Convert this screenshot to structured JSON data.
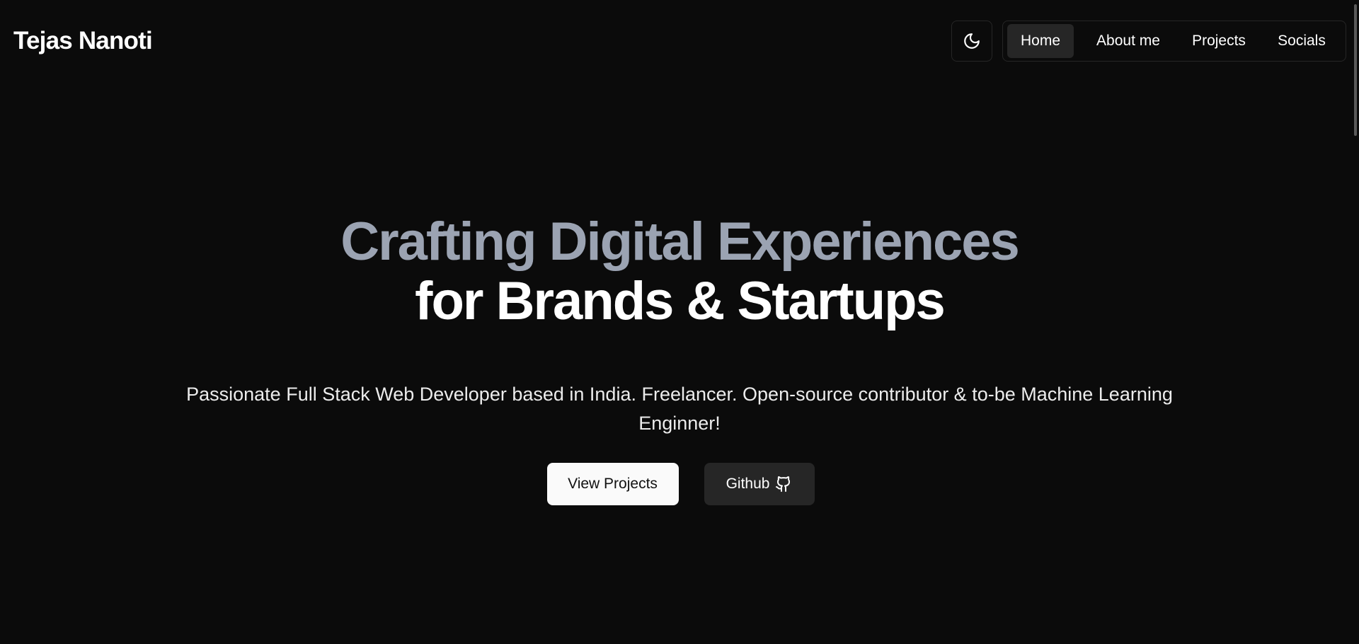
{
  "header": {
    "brand": "Tejas Nanoti",
    "theme_toggle_icon": "moon-icon",
    "nav": [
      {
        "label": "Home",
        "active": true
      },
      {
        "label": "About me",
        "active": false
      },
      {
        "label": "Projects",
        "active": false
      },
      {
        "label": "Socials",
        "active": false
      }
    ]
  },
  "hero": {
    "headline_line1": "Crafting Digital Experiences",
    "headline_line2": "for Brands & Startups",
    "subtitle": "Passionate Full Stack Web Developer based in India. Freelancer. Open-source contributor & to-be Machine Learning Enginner!",
    "primary_button": "View Projects",
    "secondary_button": "Github",
    "secondary_button_icon": "github-icon"
  },
  "colors": {
    "background": "#0b0b0b",
    "headline_muted": "#9ba3b2",
    "text": "#ffffff",
    "active_nav": "#262626",
    "primary_button": "#fafafa"
  }
}
